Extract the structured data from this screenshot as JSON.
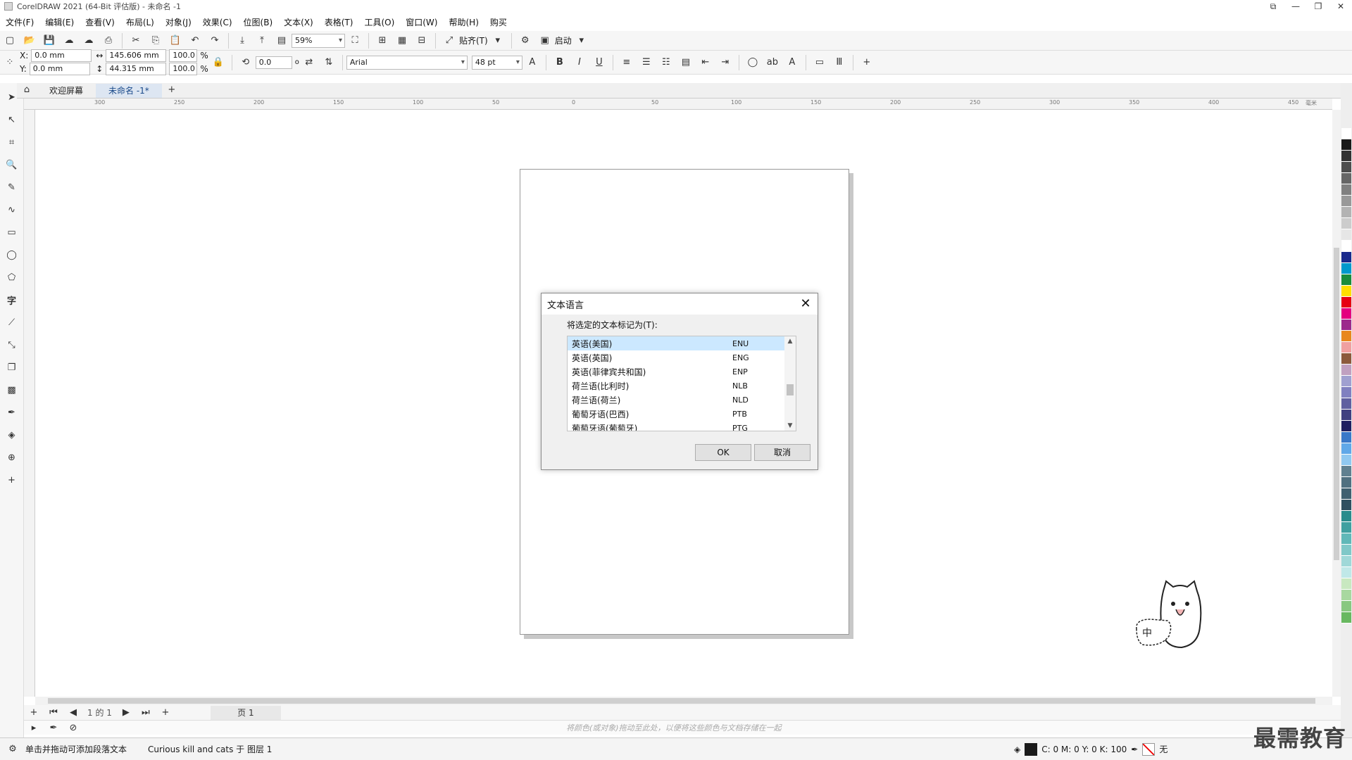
{
  "window": {
    "title": "CorelDRAW 2021 (64-Bit 评估版) - 未命名 -1"
  },
  "menu": [
    "文件(F)",
    "编辑(E)",
    "查看(V)",
    "布局(L)",
    "对象(J)",
    "效果(C)",
    "位图(B)",
    "文本(X)",
    "表格(T)",
    "工具(O)",
    "窗口(W)",
    "帮助(H)",
    "购买"
  ],
  "standard_toolbar": {
    "zoom": "59%",
    "snap_label": "贴齐(T)",
    "launch_label": "启动"
  },
  "property_bar": {
    "x_label": "X:",
    "x": "0.0 mm",
    "y_label": "Y:",
    "y": "0.0 mm",
    "width": "145.606 mm",
    "height": "44.315 mm",
    "scale_w": "100.0",
    "scale_h": "100.0",
    "percent": "%",
    "rotation": "0.0",
    "degree": "o",
    "font": "Arial",
    "font_size": "48 pt"
  },
  "tabs": {
    "welcome": "欢迎屏幕",
    "document": "未命名 -1*"
  },
  "ruler_h_ticks": [
    "300",
    "250",
    "200",
    "150",
    "100",
    "50",
    "0",
    "50",
    "100",
    "150",
    "200",
    "250",
    "300",
    "350",
    "400",
    "450"
  ],
  "ruler_unit": "毫米",
  "dialog": {
    "title": "文本语言",
    "label": "将选定的文本标记为(T):",
    "languages": [
      {
        "name": "英语(美国)",
        "code": "ENU"
      },
      {
        "name": "英语(英国)",
        "code": "ENG"
      },
      {
        "name": "英语(菲律宾共和国)",
        "code": "ENP"
      },
      {
        "name": "荷兰语(比利时)",
        "code": "NLB"
      },
      {
        "name": "荷兰语(荷兰)",
        "code": "NLD"
      },
      {
        "name": "葡萄牙语(巴西)",
        "code": "PTB"
      },
      {
        "name": "葡萄牙语(葡萄牙)",
        "code": "PTG"
      }
    ],
    "ok": "OK",
    "cancel": "取消"
  },
  "page_nav": {
    "counter": "1 的 1",
    "page_tab": "页 1"
  },
  "color_hint": "将颜色(或对象)拖动至此处，以便将这些颜色与文档存储在一起",
  "status": {
    "hint": "单击并拖动可添加段落文本",
    "object": "Curious kill and cats 于 图层 1",
    "cmyk": "C: 0 M: 0 Y: 0 K: 100",
    "outline": "无"
  },
  "mascot_text": "中",
  "watermark": "最需教育",
  "palette_colors": [
    "#ffffff",
    "#1a1a1a",
    "#333333",
    "#4d4d4d",
    "#666666",
    "#808080",
    "#999999",
    "#b3b3b3",
    "#cccccc",
    "#e6e6e6",
    "#ffffff",
    "#1a2a8c",
    "#0099cc",
    "#1a8c3c",
    "#ffde00",
    "#e60012",
    "#e4007f",
    "#9c2a8c",
    "#e8871e",
    "#f0a0a0",
    "#8c5a3c",
    "#c0a0c0",
    "#a0a0d0",
    "#8080c0",
    "#6060a0",
    "#404080",
    "#202060",
    "#3a78c8",
    "#60a8e8",
    "#90c8f0",
    "#608090",
    "#507080",
    "#406070",
    "#305060",
    "#2a8c8c",
    "#40a0a0",
    "#60b8b8",
    "#80c8c8",
    "#a0d8d8",
    "#c0e8e8",
    "#c8e8c0",
    "#a8d8a0",
    "#88c880",
    "#68b860"
  ]
}
